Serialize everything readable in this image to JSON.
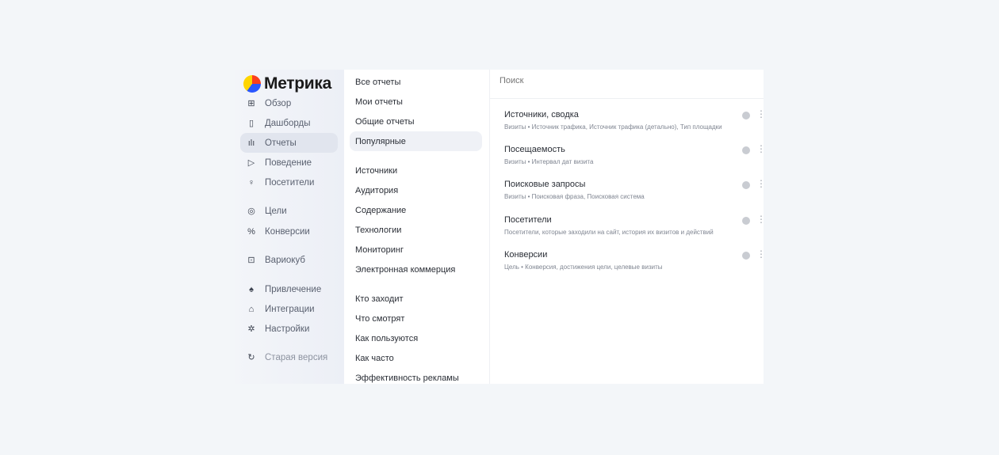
{
  "logo": {
    "text": "Метрика"
  },
  "sidebar": {
    "items": [
      {
        "label": "Обзор",
        "icon": "grid-icon",
        "glyph": "⊞"
      },
      {
        "label": "Дашборды",
        "icon": "dashboards-icon",
        "glyph": "▯"
      },
      {
        "label": "Отчеты",
        "icon": "bar-chart-icon",
        "glyph": "ılı"
      },
      {
        "label": "Поведение",
        "icon": "play-icon",
        "glyph": "▷"
      },
      {
        "label": "Посетители",
        "icon": "user-icon",
        "glyph": "♀"
      },
      {
        "label": "Цели",
        "icon": "target-icon",
        "glyph": "◎"
      },
      {
        "label": "Конверсии",
        "icon": "percent-icon",
        "glyph": "%"
      },
      {
        "label": "Вариокуб",
        "icon": "variocube-icon",
        "glyph": "⊡"
      },
      {
        "label": "Привлечение",
        "icon": "flame-icon",
        "glyph": "♠"
      },
      {
        "label": "Интеграции",
        "icon": "puzzle-icon",
        "glyph": "⌂"
      },
      {
        "label": "Настройки",
        "icon": "gear-icon",
        "glyph": "✲"
      },
      {
        "label": "Старая версия",
        "icon": "undo-icon",
        "glyph": "↻"
      }
    ]
  },
  "middle": {
    "items": [
      "Все отчеты",
      "Мои отчеты",
      "Общие отчеты",
      "Популярные",
      "Источники",
      "Аудитория",
      "Содержание",
      "Технологии",
      "Мониторинг",
      "Электронная коммерция",
      "Кто заходит",
      "Что смотрят",
      "Как пользуются",
      "Как часто",
      "Эффективность рекламы"
    ]
  },
  "search": {
    "placeholder": "Поиск"
  },
  "reports": [
    {
      "title": "Источники, сводка",
      "subtitle": "Визиты • Источник трафика, Источник трафика (детально), Тип площадки"
    },
    {
      "title": "Посещаемость",
      "subtitle": "Визиты • Интервал дат визита"
    },
    {
      "title": "Поисковые запросы",
      "subtitle": "Визиты • Поисковая фраза, Поисковая система"
    },
    {
      "title": "Посетители",
      "subtitle": "Посетители, которые заходили на сайт, история их визитов и действий"
    },
    {
      "title": "Конверсии",
      "subtitle": "Цель • Конверсия, достижения цели, целевые визиты"
    }
  ],
  "report_icons": {
    "pie": "pie-chart-icon",
    "menu": "more-vertical-icon",
    "menu_glyph": "⋮"
  }
}
